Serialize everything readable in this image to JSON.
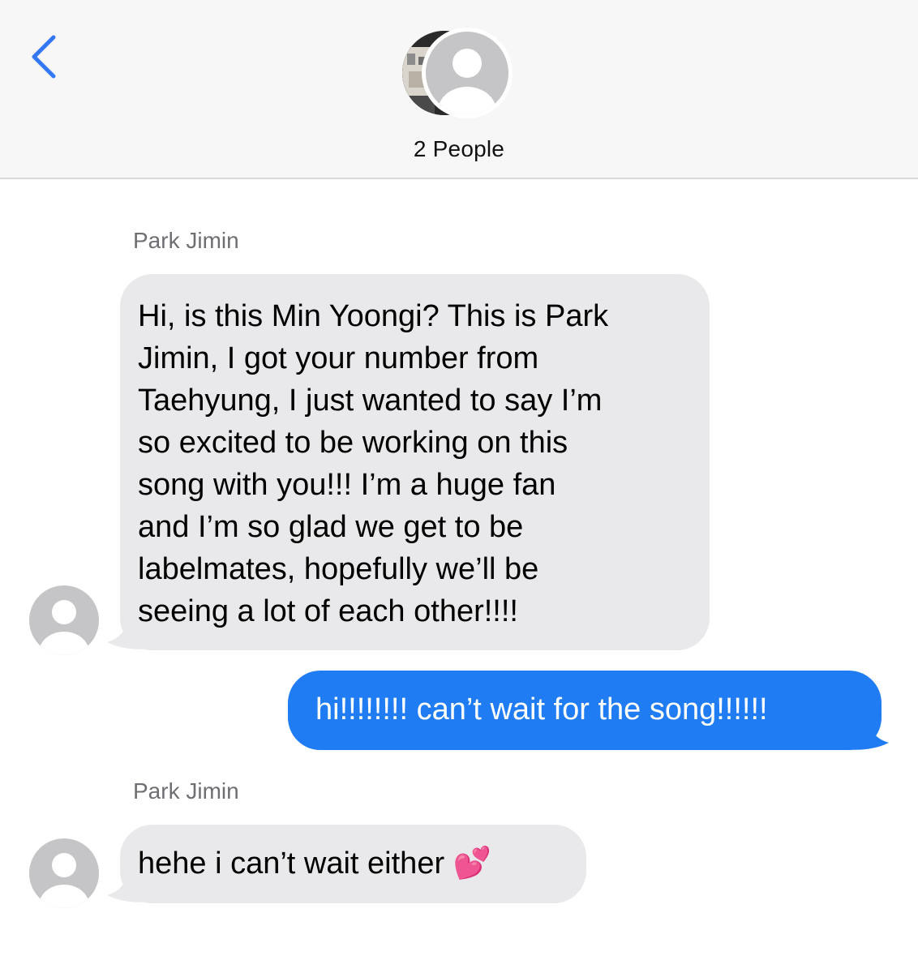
{
  "header": {
    "title": "2 People",
    "back_icon": "chevron-left-icon",
    "accent_color": "#3478f6"
  },
  "colors": {
    "incoming_bubble": "#e9e9eb",
    "outgoing_bubble": "#1f7cf3",
    "sender_name": "#6e6e73"
  },
  "messages": [
    {
      "direction": "incoming",
      "sender": "Park Jimin",
      "text": "Hi, is this Min Yoongi? This is Park\nJimin, I got your number from\nTaehyung, I just wanted to say I’m\nso excited to be working on this\nsong with you!!! I’m a huge fan\nand I’m so glad we get to be\nlabelmates, hopefully we’ll be\nseeing a lot of each other!!!!"
    },
    {
      "direction": "outgoing",
      "text": "hi!!!!!!!! can’t wait for the song!!!!!!"
    },
    {
      "direction": "incoming",
      "sender": "Park Jimin",
      "text": "hehe i can’t wait either 💕"
    }
  ]
}
